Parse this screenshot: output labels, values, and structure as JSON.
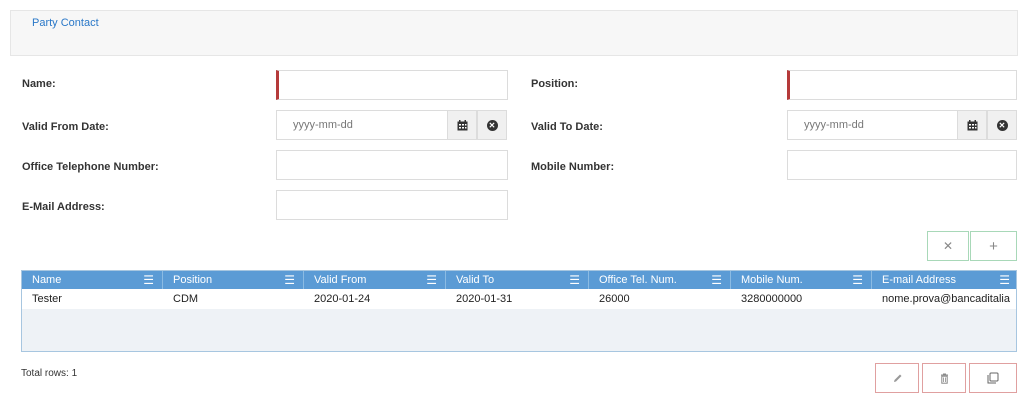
{
  "header": {
    "title": "Party Contact"
  },
  "form": {
    "name_label": "Name:",
    "position_label": "Position:",
    "valid_from_label": "Valid From Date:",
    "valid_to_label": "Valid To Date:",
    "office_tel_label": "Office Telephone Number:",
    "mobile_label": "Mobile Number:",
    "email_label": "E-Mail Address:",
    "date_placeholder": "yyyy-mm-dd"
  },
  "table": {
    "columns": [
      "Name",
      "Position",
      "Valid From",
      "Valid To",
      "Office Tel. Num.",
      "Mobile Num.",
      "E-mail Address"
    ],
    "rows": [
      [
        "Tester",
        "CDM",
        "2020-01-24",
        "2020-01-31",
        "26000",
        "3280000000",
        "nome.prova@bancaditalia"
      ]
    ],
    "menu_glyph": "☰"
  },
  "footer": {
    "total_rows": "Total rows: 1"
  },
  "icons": {
    "calendar": "calendar-icon",
    "clear": "clear-circle-icon",
    "x": "close-icon",
    "plus": "plus-icon",
    "edit": "pencil-icon",
    "delete": "trash-icon",
    "copy": "copy-icon"
  },
  "colors": {
    "link": "#2a78c8",
    "required": "#b53a3a",
    "grid_header": "#5b9bd5",
    "green_border": "#a8d8b8",
    "red_border": "#e0a0a0"
  }
}
